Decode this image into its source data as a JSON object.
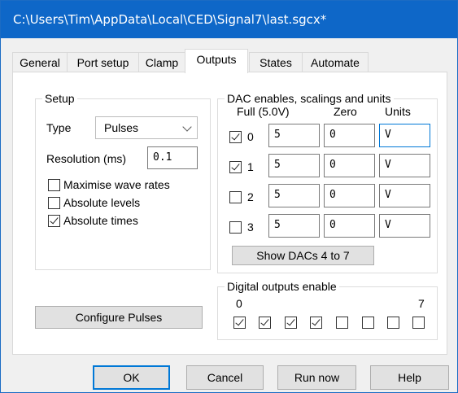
{
  "window": {
    "title": "C:\\Users\\Tim\\AppData\\Local\\CED\\Signal7\\last.sgcx*"
  },
  "tabs": [
    {
      "label": "General"
    },
    {
      "label": "Port setup"
    },
    {
      "label": "Clamp"
    },
    {
      "label": "Outputs",
      "active": true
    },
    {
      "label": "States"
    },
    {
      "label": "Automate"
    }
  ],
  "setup": {
    "title": "Setup",
    "type_label": "Type",
    "type_value": "Pulses",
    "resolution_label": "Resolution (ms)",
    "resolution_value": "0.1",
    "options": [
      {
        "label": "Maximise wave rates",
        "checked": false
      },
      {
        "label": "Absolute levels",
        "checked": false
      },
      {
        "label": "Absolute times",
        "checked": true
      }
    ]
  },
  "dac": {
    "title": "DAC enables, scalings and units",
    "col_full": "Full (5.0V)",
    "col_zero": "Zero",
    "col_units": "Units",
    "rows": [
      {
        "index": "0",
        "enabled": true,
        "full": "5",
        "zero": "0",
        "units": "V"
      },
      {
        "index": "1",
        "enabled": true,
        "full": "5",
        "zero": "0",
        "units": "V"
      },
      {
        "index": "2",
        "enabled": false,
        "full": "5",
        "zero": "0",
        "units": "V"
      },
      {
        "index": "3",
        "enabled": false,
        "full": "5",
        "zero": "0",
        "units": "V"
      }
    ],
    "show_more_label": "Show DACs 4 to 7"
  },
  "digital": {
    "title": "Digital outputs enable",
    "first_label": "0",
    "last_label": "7",
    "bits": [
      true,
      true,
      true,
      true,
      false,
      false,
      false,
      false
    ]
  },
  "configure_button": "Configure Pulses",
  "buttons": {
    "ok": "OK",
    "cancel": "Cancel",
    "run_now": "Run now",
    "help": "Help"
  }
}
